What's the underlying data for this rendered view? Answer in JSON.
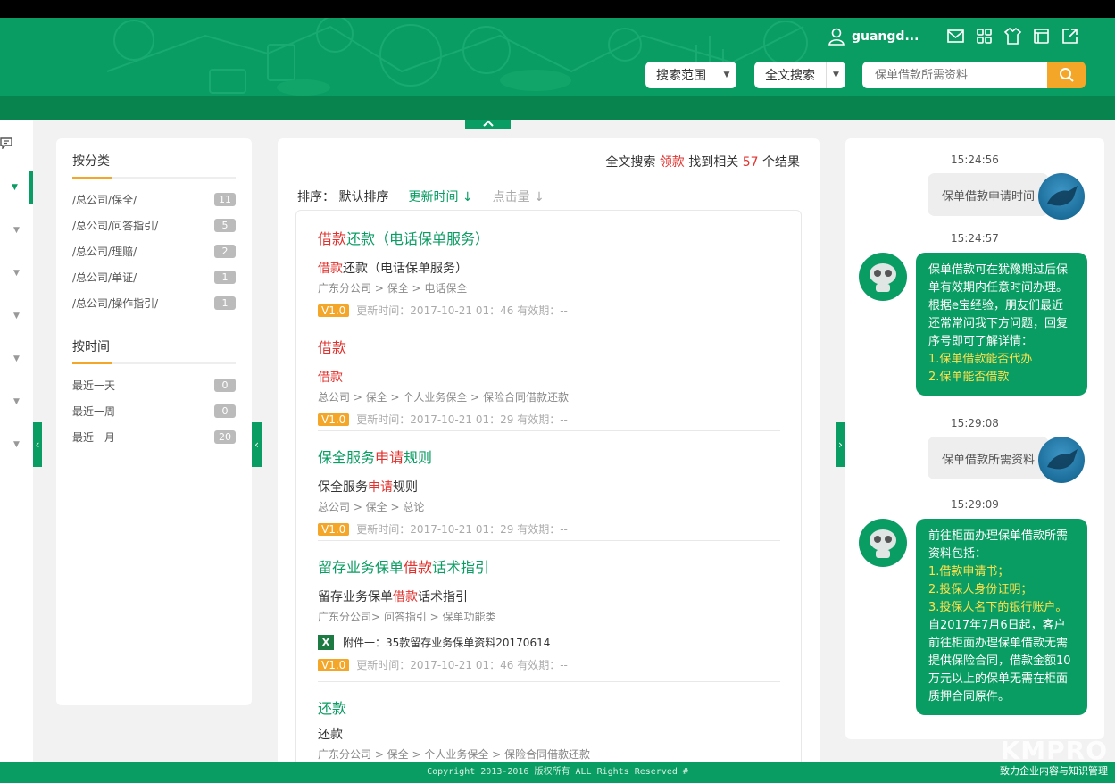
{
  "header": {
    "username": "guangd...",
    "scope_select": "搜索范围",
    "mode_select": "全文搜索",
    "search_placeholder": "保单借款所需资料"
  },
  "filter": {
    "category_title": "按分类",
    "categories": [
      {
        "label": "/总公司/保全/",
        "count": "11"
      },
      {
        "label": "/总公司/问答指引/",
        "count": "5"
      },
      {
        "label": "/总公司/理赔/",
        "count": "2"
      },
      {
        "label": "/总公司/单证/",
        "count": "1"
      },
      {
        "label": "/总公司/操作指引/",
        "count": "1"
      }
    ],
    "time_title": "按时间",
    "times": [
      {
        "label": "最近一天",
        "count": "0"
      },
      {
        "label": "最近一周",
        "count": "0"
      },
      {
        "label": "最近一月",
        "count": "20"
      }
    ]
  },
  "results": {
    "summary_prefix": "全文搜索",
    "keyword": "领款",
    "summary_mid": "找到相关",
    "total": "57",
    "summary_suffix": "个结果",
    "sort_label": "排序：",
    "sort_default": "默认排序",
    "sort_updated": "更新时间",
    "sort_clicks": "点击量",
    "items": [
      {
        "title_red": "借款",
        "title_rest": "还款（电话保单服务）",
        "sub_red": "借款",
        "sub_rest": "还款（电话保单服务）",
        "path": "广东分公司 > 保全 > 电话保全",
        "version": "V1.0",
        "meta": "更新时间：2017-10-21 01：46  有效期：--"
      },
      {
        "title_red": "借款",
        "title_rest": "",
        "sub_red": "借款",
        "sub_rest": "",
        "path": "总公司 > 保全 > 个人业务保全 > 保险合同借款还款",
        "version": "V1.0",
        "meta": "更新时间：2017-10-21 01：29  有效期：--"
      },
      {
        "title_pre": "保全服务",
        "title_red": "申请",
        "title_rest": "规则",
        "sub_pre": "保全服务",
        "sub_red": "申请",
        "sub_rest": "规则",
        "path": "总公司 > 保全 > 总论",
        "version": "V1.0",
        "meta": "更新时间：2017-10-21 01：29  有效期：--"
      },
      {
        "title_pre": "留存业务保单",
        "title_red": "借款",
        "title_rest": "话术指引",
        "sub_pre": "留存业务保单",
        "sub_red": "借款",
        "sub_rest": "话术指引",
        "path": "广东分公司> 问答指引 > 保单功能类",
        "attachment": "附件一：35款留存业务保单资料20170614",
        "version": "V1.0",
        "meta": "更新时间：2017-10-21 01：46  有效期：--"
      },
      {
        "title": "还款",
        "sub": "还款",
        "path": "广东分公司 > 保全 > 个人业务保全 > 保险合同借款还款"
      }
    ]
  },
  "chat": {
    "messages": [
      {
        "time": "15:24:56",
        "user": "保单借款申请时间"
      },
      {
        "time": "15:24:57",
        "bot": [
          "保单借款可在犹豫期过后保",
          "单有效期内任意时间办理。",
          "根据e宝经验，朋友们最近",
          "还常常问我下方问题，回复",
          "序号即可了解详情："
        ],
        "bot_options": [
          "1.保单借款能否代办",
          "2.保单能否借款"
        ]
      },
      {
        "time": "15:29:08",
        "user": "保单借款所需资料"
      },
      {
        "time": "15:29:09",
        "bot_a": [
          "前往柜面办理保单借款所需",
          "资料包括："
        ],
        "bot_options": [
          "1.借款申请书；",
          "2.投保人身份证明；",
          "3.投保人名下的银行账户。"
        ],
        "bot_b": [
          "自2017年7月6日起，客户",
          "前往柜面办理保单借款无需",
          "提供保险合同，借款金额10",
          "万元以上的保单无需在柜面",
          "质押合同原件。"
        ]
      }
    ]
  },
  "footer": {
    "copyright": "Copyright 2013-2016 版权所有 ALL Rights Reserved #",
    "brand": "KMPRO",
    "slogan": "致力企业内容与知识管理"
  },
  "colors": {
    "primary": "#0a9d63",
    "accent": "#f4a629",
    "highlight": "#e0332f"
  }
}
